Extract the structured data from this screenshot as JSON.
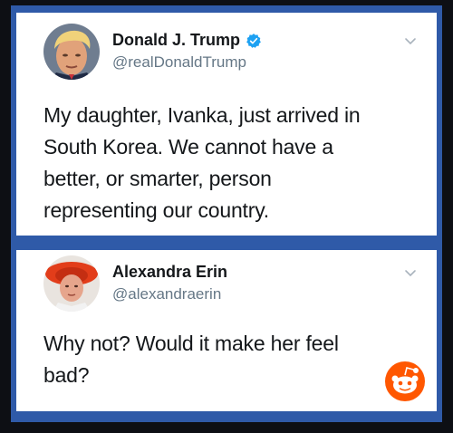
{
  "tweets": [
    {
      "display_name": "Donald J. Trump",
      "handle": "@realDonaldTrump",
      "verified": true,
      "text_lines": [
        "My daughter, Ivanka, just arrived in",
        "South Korea. We cannot have a",
        "better, or smarter, person",
        "representing our country."
      ]
    },
    {
      "display_name": "Alexandra Erin",
      "handle": "@alexandraerin",
      "verified": false,
      "text_lines": [
        "Why not? Would it make her feel",
        "bad?"
      ]
    }
  ],
  "icons": {
    "verified": "verified-badge-icon",
    "chevron": "chevron-down-icon",
    "watermark": "reddit-snoo-icon"
  },
  "colors": {
    "frame_blue": "#2f5aa8",
    "verified_blue": "#1da1f2",
    "reddit_orange": "#ff5700"
  }
}
